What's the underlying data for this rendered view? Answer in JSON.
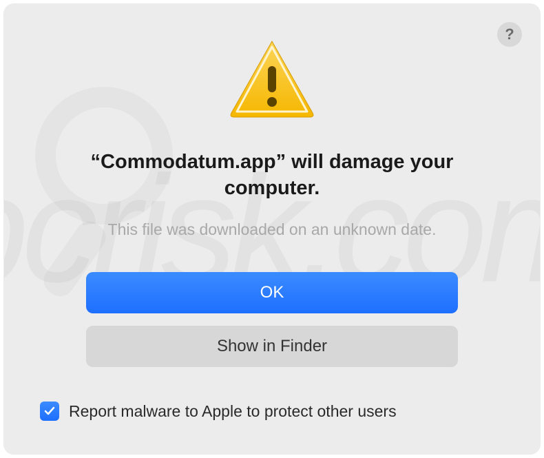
{
  "dialog": {
    "title": "“Commodatum.app” will damage your computer.",
    "subtitle": "This file was downloaded on an unknown date.",
    "primary_button": "OK",
    "secondary_button": "Show in Finder",
    "help_label": "?",
    "checkbox": {
      "checked": true,
      "label": "Report malware to Apple to protect other users"
    }
  },
  "icons": {
    "warning": "warning-triangle",
    "help": "help-circle",
    "checkmark": "checkmark"
  },
  "colors": {
    "primary_button": "#1e6fff",
    "secondary_button": "#d7d7d7",
    "background": "#ececec"
  }
}
